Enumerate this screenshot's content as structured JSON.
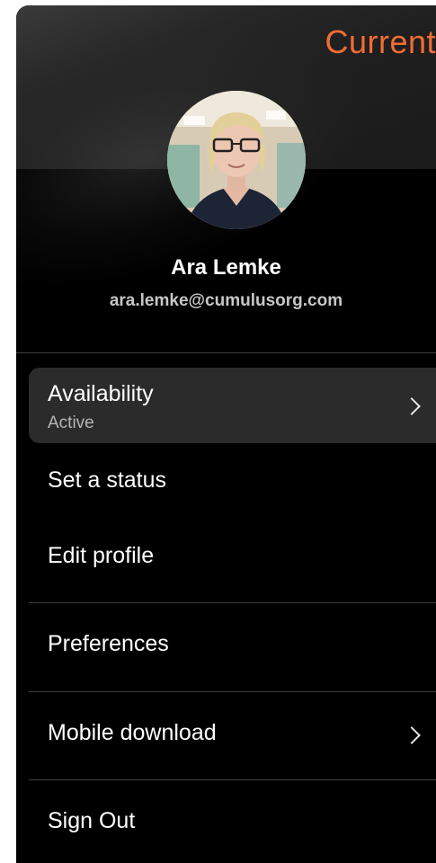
{
  "banner": {
    "title": "Current",
    "title_color": "#f26c35"
  },
  "profile": {
    "name": "Ara Lemke",
    "email": "ara.lemke@cumulusorg.com"
  },
  "menu": {
    "availability": {
      "label": "Availability",
      "status": "Active",
      "icon": "chevron-right-icon"
    },
    "set_status": {
      "label": "Set a status"
    },
    "edit_profile": {
      "label": "Edit profile"
    },
    "preferences": {
      "label": "Preferences"
    },
    "mobile_download": {
      "label": "Mobile download",
      "icon": "chevron-right-icon"
    },
    "sign_out": {
      "label": "Sign Out"
    }
  },
  "colors": {
    "panel_background": "#000000",
    "highlight_row": "#2b2b2b",
    "divider": "#3d3d3d"
  }
}
